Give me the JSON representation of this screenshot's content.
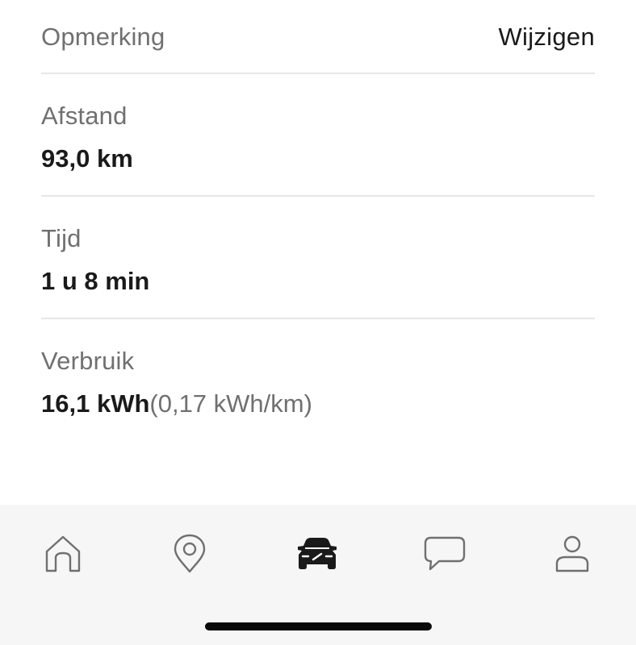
{
  "note": {
    "label": "Opmerking",
    "edit_label": "Wijzigen"
  },
  "distance": {
    "label": "Afstand",
    "value": "93,0 km"
  },
  "time": {
    "label": "Tijd",
    "value": "1 u 8 min"
  },
  "consumption": {
    "label": "Verbruik",
    "value": "16,1 kWh",
    "per_km": "(0,17 kWh/km)"
  },
  "tabbar": {
    "active_tab": "car",
    "active_color": "#1a1a1a",
    "inactive_color": "#707070",
    "tabs": [
      {
        "id": "home",
        "icon": "home-icon"
      },
      {
        "id": "location",
        "icon": "map-pin-icon"
      },
      {
        "id": "car",
        "icon": "car-icon"
      },
      {
        "id": "messages",
        "icon": "chat-bubble-icon"
      },
      {
        "id": "profile",
        "icon": "user-icon"
      }
    ]
  }
}
